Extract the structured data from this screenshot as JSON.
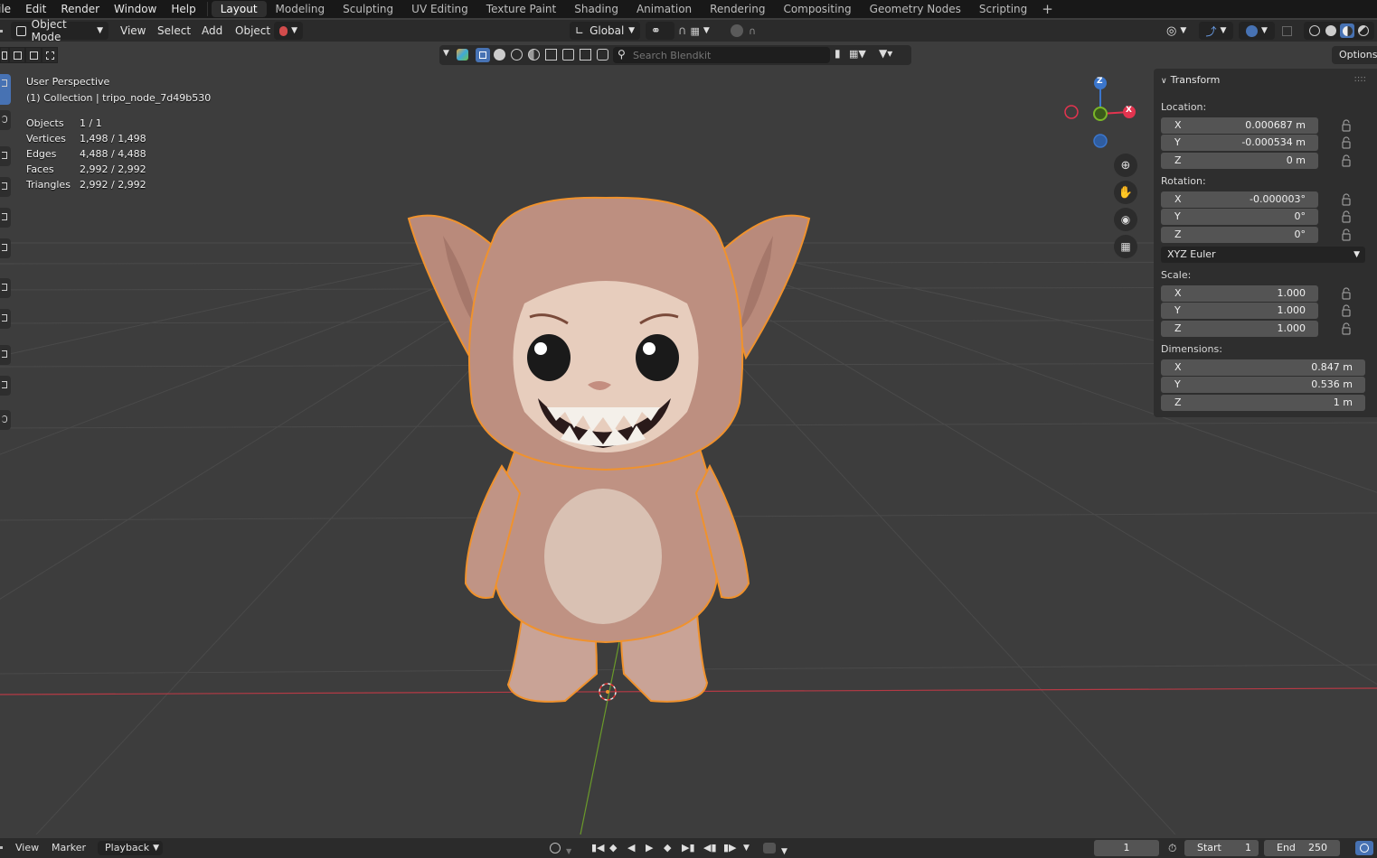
{
  "menu": {
    "file_partial": "ile",
    "items": [
      "Edit",
      "Render",
      "Window",
      "Help"
    ]
  },
  "workspaces": [
    "Layout",
    "Modeling",
    "Sculpting",
    "UV Editing",
    "Texture Paint",
    "Shading",
    "Animation",
    "Rendering",
    "Compositing",
    "Geometry Nodes",
    "Scripting"
  ],
  "active_workspace": "Layout",
  "header": {
    "mode": "Object Mode",
    "menus": [
      "View",
      "Select",
      "Add",
      "Object"
    ],
    "transform_orientation": "Global"
  },
  "blendkit": {
    "search_placeholder": "Search Blendkit"
  },
  "options_label": "Options",
  "viewport_info": {
    "perspective": "User Perspective",
    "collection": "(1) Collection | tripo_node_7d49b530"
  },
  "stats": [
    {
      "label": "Objects",
      "value": "1 / 1"
    },
    {
      "label": "Vertices",
      "value": "1,498 / 1,498"
    },
    {
      "label": "Edges",
      "value": "4,488 / 4,488"
    },
    {
      "label": "Faces",
      "value": "2,992 / 2,992"
    },
    {
      "label": "Triangles",
      "value": "2,992 / 2,992"
    }
  ],
  "gizmo": {
    "z": "Z",
    "x": "X"
  },
  "npanel": {
    "title": "Transform",
    "location_label": "Location:",
    "location": [
      {
        "axis": "X",
        "value": "0.000687 m"
      },
      {
        "axis": "Y",
        "value": "-0.000534 m"
      },
      {
        "axis": "Z",
        "value": "0 m"
      }
    ],
    "rotation_label": "Rotation:",
    "rotation": [
      {
        "axis": "X",
        "value": "-0.000003°"
      },
      {
        "axis": "Y",
        "value": "0°"
      },
      {
        "axis": "Z",
        "value": "0°"
      }
    ],
    "rotation_mode": "XYZ Euler",
    "scale_label": "Scale:",
    "scale": [
      {
        "axis": "X",
        "value": "1.000"
      },
      {
        "axis": "Y",
        "value": "1.000"
      },
      {
        "axis": "Z",
        "value": "1.000"
      }
    ],
    "dimensions_label": "Dimensions:",
    "dimensions": [
      {
        "axis": "X",
        "value": "0.847 m"
      },
      {
        "axis": "Y",
        "value": "0.536 m"
      },
      {
        "axis": "Z",
        "value": "1 m"
      }
    ]
  },
  "timeline": {
    "view": "View",
    "marker": "Marker",
    "playback": "Playback",
    "current_frame": "1",
    "start_label": "Start",
    "start": "1",
    "end_label": "End",
    "end": "250"
  },
  "colors": {
    "selection_outline": "#f0922d",
    "x_axis": "#e3344f",
    "y_axis": "#7ab628",
    "z_axis": "#3b76cc",
    "accent_blue": "#4772b3"
  }
}
